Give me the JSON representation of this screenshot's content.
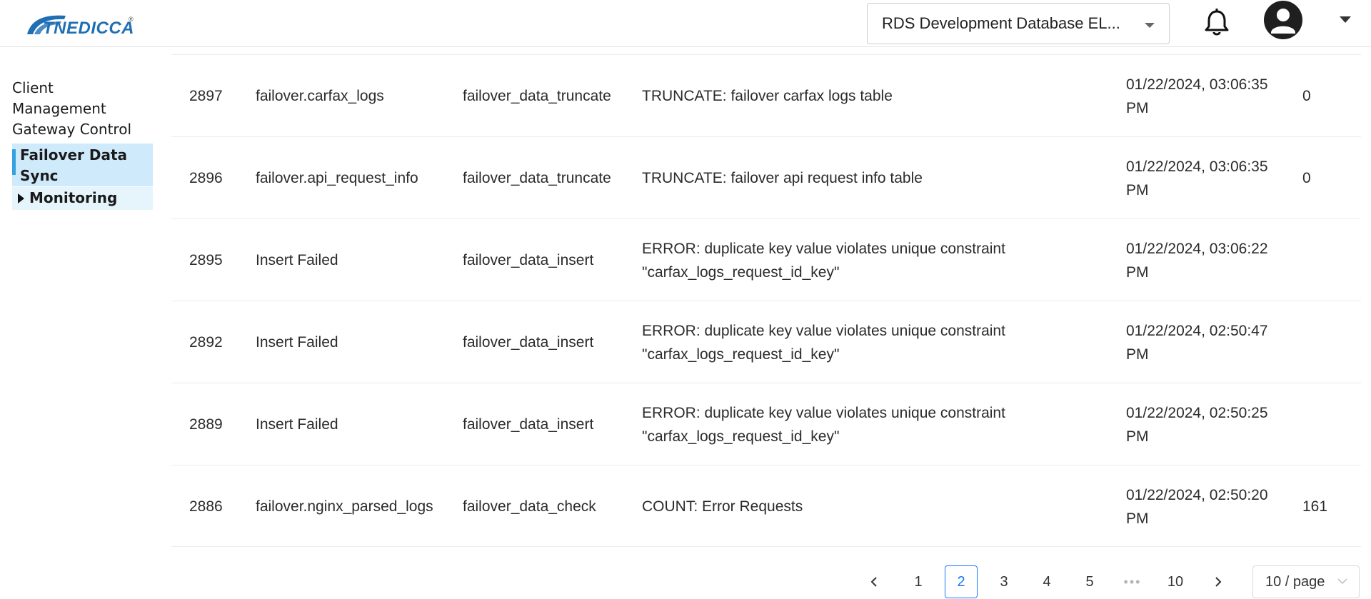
{
  "header": {
    "logo_text": "TNEDICCA",
    "logo_reg": "®",
    "database_select": {
      "value": "RDS Development Database EL...",
      "caret": "chevron-down-icon"
    },
    "notifications_icon": "bell-icon",
    "user_icon": "user-avatar-icon",
    "user_menu_icon": "caret-down-icon"
  },
  "sidebar": {
    "items": [
      {
        "label": "Client Management",
        "active": false
      },
      {
        "label": "Gateway Control",
        "active": false
      },
      {
        "label": "Failover Data Sync",
        "active": true
      },
      {
        "label": "Monitoring",
        "active": false,
        "expandable": true
      }
    ]
  },
  "table": {
    "rows": [
      {
        "id": "2897",
        "name": "failover.carfax_logs",
        "job": "failover_data_truncate",
        "message": "TRUNCATE: failover carfax logs table",
        "time": "01/22/2024, 03:06:35 PM",
        "count": "0"
      },
      {
        "id": "2896",
        "name": "failover.api_request_info",
        "job": "failover_data_truncate",
        "message": "TRUNCATE: failover api request info table",
        "time": "01/22/2024, 03:06:35 PM",
        "count": "0"
      },
      {
        "id": "2895",
        "name": "Insert Failed",
        "job": "failover_data_insert",
        "message": "ERROR: duplicate key value violates unique constraint \"carfax_logs_request_id_key\"",
        "time": "01/22/2024, 03:06:22 PM",
        "count": ""
      },
      {
        "id": "2892",
        "name": "Insert Failed",
        "job": "failover_data_insert",
        "message": "ERROR: duplicate key value violates unique constraint \"carfax_logs_request_id_key\"",
        "time": "01/22/2024, 02:50:47 PM",
        "count": ""
      },
      {
        "id": "2889",
        "name": "Insert Failed",
        "job": "failover_data_insert",
        "message": "ERROR: duplicate key value violates unique constraint \"carfax_logs_request_id_key\"",
        "time": "01/22/2024, 02:50:25 PM",
        "count": ""
      },
      {
        "id": "2886",
        "name": "failover.nginx_parsed_logs",
        "job": "failover_data_check",
        "message": "COUNT: Error Requests",
        "time": "01/22/2024, 02:50:20 PM",
        "count": "161"
      }
    ]
  },
  "pagination": {
    "prev_icon": "chevron-left-icon",
    "next_icon": "chevron-right-icon",
    "pages": [
      "1",
      "2",
      "3",
      "4",
      "5"
    ],
    "ellipsis": "•••",
    "last_page": "10",
    "current_page": "2",
    "page_size": "10 / page",
    "accent": "#1677ff"
  },
  "colors": {
    "active_nav_bg": "#cfeafb",
    "active_nav_bar": "#35a2e0",
    "monitoring_bg": "#e6f4fc",
    "logo_blue": "#1f6fb5"
  }
}
